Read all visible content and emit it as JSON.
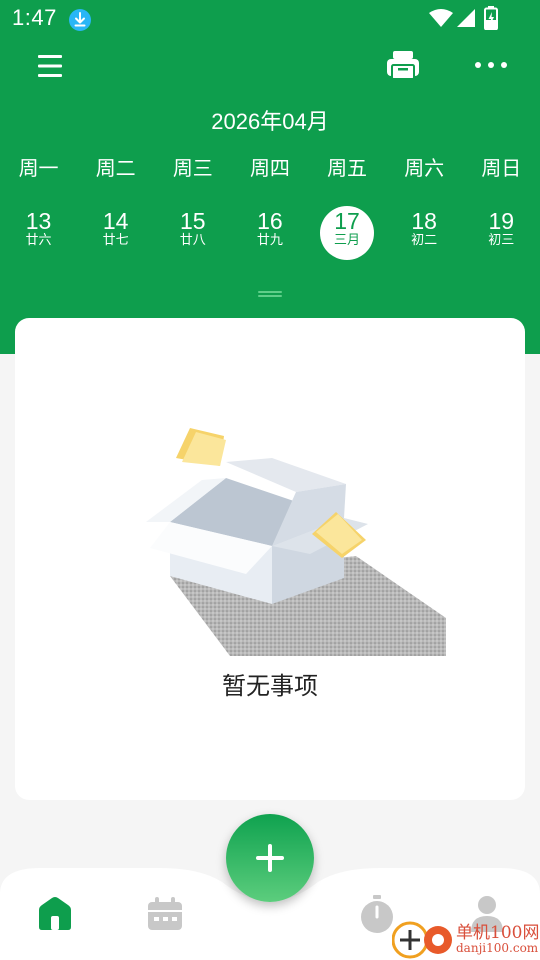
{
  "status_bar": {
    "time": "1:47"
  },
  "toolbar": {
    "menu_icon": "hamburger-menu-icon",
    "print_icon": "printer-icon",
    "more_icon": "more-dots-icon"
  },
  "calendar": {
    "month_title": "2026年04月",
    "weekdays": [
      "周一",
      "周二",
      "周三",
      "周四",
      "周五",
      "周六",
      "周日"
    ],
    "days": [
      {
        "num": "13",
        "lunar": "廿六"
      },
      {
        "num": "14",
        "lunar": "廿七"
      },
      {
        "num": "15",
        "lunar": "廿八"
      },
      {
        "num": "16",
        "lunar": "廿九"
      },
      {
        "num": "17",
        "lunar": "三月",
        "selected": true
      },
      {
        "num": "18",
        "lunar": "初二"
      },
      {
        "num": "19",
        "lunar": "初三"
      }
    ]
  },
  "content": {
    "empty_text": "暂无事项"
  },
  "bottom_nav": {
    "items": [
      "home-icon",
      "calendar-icon",
      "timer-icon",
      "profile-icon"
    ],
    "fab_icon": "plus-icon"
  },
  "watermark": {
    "text": "单机100网",
    "url": "danji100.com"
  },
  "colors": {
    "brand_green": "#0e9e4d",
    "background": "#f5f5f5"
  }
}
